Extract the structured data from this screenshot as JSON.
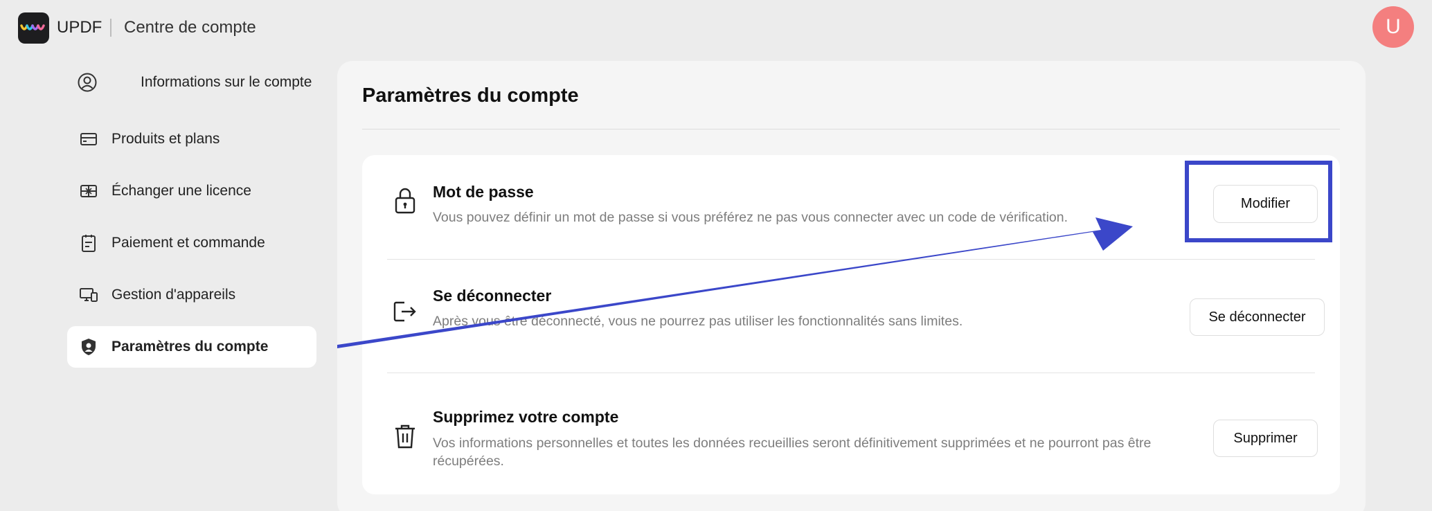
{
  "header": {
    "brand": "UPDF",
    "title": "Centre de compte",
    "avatar_initial": "U"
  },
  "sidebar": {
    "items": [
      {
        "label": "Informations sur le compte",
        "icon": "user-circle-icon"
      },
      {
        "label": "Produits et plans",
        "icon": "card-icon"
      },
      {
        "label": "Échanger une licence",
        "icon": "gift-card-icon"
      },
      {
        "label": "Paiement et commande",
        "icon": "clipboard-icon"
      },
      {
        "label": "Gestion d'appareils",
        "icon": "devices-icon"
      },
      {
        "label": "Paramètres du compte",
        "icon": "shield-user-icon",
        "active": true
      }
    ]
  },
  "main": {
    "title": "Paramètres du compte",
    "rows": [
      {
        "title": "Mot de passe",
        "description": "Vous pouvez définir un mot de passe si vous préférez ne pas vous connecter avec un code de vérification.",
        "button": "Modifier",
        "icon": "lock-icon"
      },
      {
        "title": "Se déconnecter",
        "description": "Après vous être déconnecté, vous ne pourrez pas utiliser les fonctionnalités sans limites.",
        "button": "Se déconnecter",
        "icon": "logout-icon"
      },
      {
        "title": "Supprimez votre compte",
        "description": "Vos informations personnelles et toutes les données recueillies seront définitivement supprimées et ne pourront pas être récupérées.",
        "button": "Supprimer",
        "icon": "trash-icon"
      }
    ]
  },
  "colors": {
    "annotation": "#3b47c9",
    "avatar": "#f47f7f",
    "background": "#ececec"
  }
}
